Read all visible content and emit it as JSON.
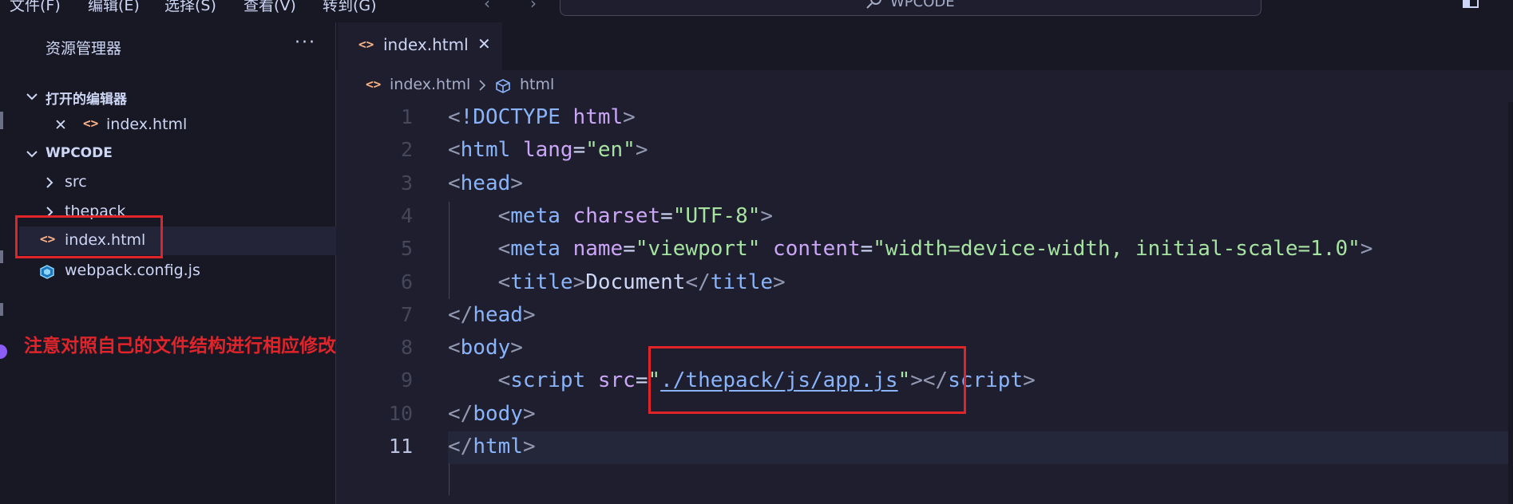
{
  "menubar": {
    "items": [
      "文件(F)",
      "编辑(E)",
      "选择(S)",
      "查看(V)",
      "转到(G)"
    ],
    "command_center_title": "WPCODE"
  },
  "explorer": {
    "title": "资源管理器",
    "more_label": "···",
    "open_editors_label": "打开的编辑器",
    "open_editors": [
      {
        "name": "index.html",
        "icon": "html-file-icon"
      }
    ],
    "workspace_label": "WPCODE",
    "tree": [
      {
        "name": "src",
        "type": "folder",
        "icon": "chevron-right-icon"
      },
      {
        "name": "thepack",
        "type": "folder",
        "icon": "chevron-right-icon"
      },
      {
        "name": "index.html",
        "type": "file",
        "icon": "html-file-icon",
        "selected": true
      },
      {
        "name": "webpack.config.js",
        "type": "file",
        "icon": "webpack-icon"
      }
    ],
    "annotation": "注意对照自己的文件结构进行相应修改"
  },
  "tabs": [
    {
      "label": "index.html",
      "icon": "html-file-icon",
      "active": true
    }
  ],
  "breadcrumb": {
    "file": "index.html",
    "symbol": "html"
  },
  "editor": {
    "current_line": 11,
    "lines": [
      {
        "n": "1",
        "tokens": [
          [
            "br",
            "<"
          ],
          [
            "tag",
            "!DOCTYPE"
          ],
          [
            "ink",
            " "
          ],
          [
            "kw",
            "html"
          ],
          [
            "br",
            ">"
          ]
        ]
      },
      {
        "n": "2",
        "tokens": [
          [
            "br",
            "<"
          ],
          [
            "tag",
            "html"
          ],
          [
            "ink",
            " "
          ],
          [
            "attr",
            "lang"
          ],
          [
            "ink",
            "="
          ],
          [
            "str",
            "\"en\""
          ],
          [
            "br",
            ">"
          ]
        ]
      },
      {
        "n": "3",
        "tokens": [
          [
            "br",
            "<"
          ],
          [
            "tag",
            "head"
          ],
          [
            "br",
            ">"
          ]
        ]
      },
      {
        "n": "4",
        "tokens": [
          [
            "ink",
            "    "
          ],
          [
            "br",
            "<"
          ],
          [
            "tag",
            "meta"
          ],
          [
            "ink",
            " "
          ],
          [
            "attr",
            "charset"
          ],
          [
            "ink",
            "="
          ],
          [
            "str",
            "\"UTF-8\""
          ],
          [
            "br",
            ">"
          ]
        ]
      },
      {
        "n": "5",
        "tokens": [
          [
            "ink",
            "    "
          ],
          [
            "br",
            "<"
          ],
          [
            "tag",
            "meta"
          ],
          [
            "ink",
            " "
          ],
          [
            "attr",
            "name"
          ],
          [
            "ink",
            "="
          ],
          [
            "str",
            "\"viewport\""
          ],
          [
            "ink",
            " "
          ],
          [
            "attr",
            "content"
          ],
          [
            "ink",
            "="
          ],
          [
            "str",
            "\"width=device-width, initial-scale=1.0\""
          ],
          [
            "br",
            ">"
          ]
        ]
      },
      {
        "n": "6",
        "tokens": [
          [
            "ink",
            "    "
          ],
          [
            "br",
            "<"
          ],
          [
            "tag",
            "title"
          ],
          [
            "br",
            ">"
          ],
          [
            "plain",
            "Document"
          ],
          [
            "br",
            "</"
          ],
          [
            "tag",
            "title"
          ],
          [
            "br",
            ">"
          ]
        ]
      },
      {
        "n": "7",
        "tokens": [
          [
            "br",
            "</"
          ],
          [
            "tag",
            "head"
          ],
          [
            "br",
            ">"
          ]
        ]
      },
      {
        "n": "8",
        "tokens": [
          [
            "br",
            "<"
          ],
          [
            "tag",
            "body"
          ],
          [
            "br",
            ">"
          ]
        ]
      },
      {
        "n": "9",
        "tokens": [
          [
            "ink",
            "    "
          ],
          [
            "br",
            "<"
          ],
          [
            "tag",
            "script"
          ],
          [
            "ink",
            " "
          ],
          [
            "attr",
            "src"
          ],
          [
            "ink",
            "="
          ],
          [
            "str",
            "\""
          ],
          [
            "link",
            "./thepack/js/app.js"
          ],
          [
            "str",
            "\""
          ],
          [
            "br",
            ">"
          ],
          [
            "br",
            "</"
          ],
          [
            "tag",
            "script"
          ],
          [
            "br",
            ">"
          ]
        ]
      },
      {
        "n": "10",
        "tokens": [
          [
            "br",
            "</"
          ],
          [
            "tag",
            "body"
          ],
          [
            "br",
            ">"
          ]
        ]
      },
      {
        "n": "11",
        "tokens": [
          [
            "br",
            "</"
          ],
          [
            "tag",
            "html"
          ],
          [
            "br",
            ">"
          ]
        ]
      }
    ]
  },
  "colors": {
    "background": "#1e1e2e",
    "sidebar": "#181825",
    "annotation_red": "#e0242a",
    "html_icon": "#fab387",
    "webpack_icon": "#8ed6fb"
  }
}
